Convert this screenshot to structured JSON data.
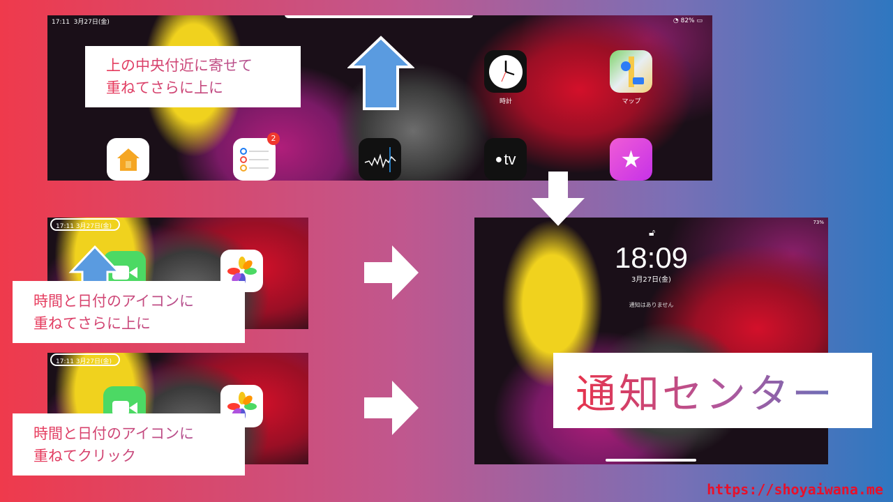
{
  "top_screenshot": {
    "status_time": "17:11",
    "status_date": "3月27日(金)",
    "status_battery": "82%",
    "apps": [
      {
        "name": "clock",
        "label": "時計"
      },
      {
        "name": "maps",
        "label": "マップ"
      },
      {
        "name": "home",
        "label": ""
      },
      {
        "name": "reminders",
        "label": "",
        "badge": "2"
      },
      {
        "name": "stocks",
        "label": ""
      },
      {
        "name": "appletv",
        "label": "tv"
      },
      {
        "name": "itunes-store",
        "label": ""
      }
    ],
    "callout_lines": [
      "上の中央付近に寄せて",
      "重ねてさらに上に"
    ]
  },
  "middle_screenshot": {
    "status_text": "17:11 3月27日(金)",
    "callout_lines": [
      "時間と日付のアイコンに",
      "重ねてさらに上に"
    ]
  },
  "bottom_screenshot": {
    "status_text": "17:11 3月27日(金)",
    "callout_lines": [
      "時間と日付のアイコンに",
      "重ねてクリック"
    ]
  },
  "lock_screen": {
    "time": "18:09",
    "date": "3月27日(金)",
    "notice": "通知はありません",
    "battery": "73%"
  },
  "title": "通知センター",
  "url": "https://shoyaiwana.me",
  "colors": {
    "url": "#e8102a",
    "arrow_blue": "#4a8fd6",
    "white": "#ffffff"
  }
}
